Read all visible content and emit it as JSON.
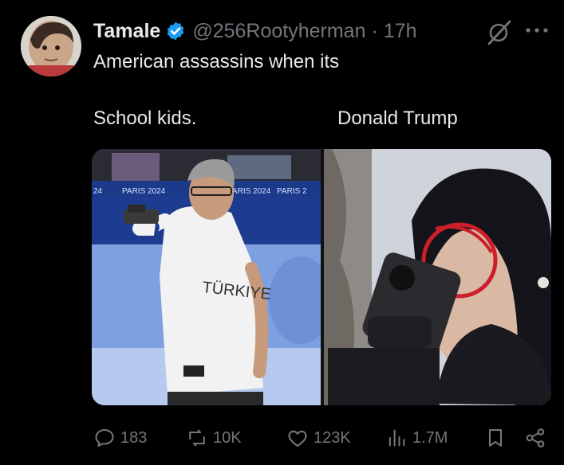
{
  "author": {
    "display_name": "Tamale",
    "handle": "@256Rootyherman",
    "separator": "·",
    "time": "17h"
  },
  "tweet": {
    "text": "American assassins when its"
  },
  "labels": {
    "left": "School kids.",
    "right": "Donald Trump"
  },
  "media": {
    "left": {
      "banner_text_1": "PARIS 2024",
      "banner_text_2": "PARIS 2024",
      "banner_text_3": "PARIS 2",
      "banner_text_0": "24",
      "shirt_text": "TÜRKIYE"
    }
  },
  "metrics": {
    "replies": "183",
    "reposts": "10K",
    "likes": "123K",
    "views": "1.7M"
  },
  "icons": {
    "verified": "verified-badge-icon",
    "grok": "grok-icon",
    "more": "more-icon",
    "reply": "reply-icon",
    "repost": "repost-icon",
    "like": "like-icon",
    "views": "views-icon",
    "bookmark": "bookmark-icon",
    "share": "share-icon"
  },
  "colors": {
    "background": "#000000",
    "text": "#e7e9ea",
    "secondary": "#71767b",
    "verified": "#1d9bf0"
  }
}
